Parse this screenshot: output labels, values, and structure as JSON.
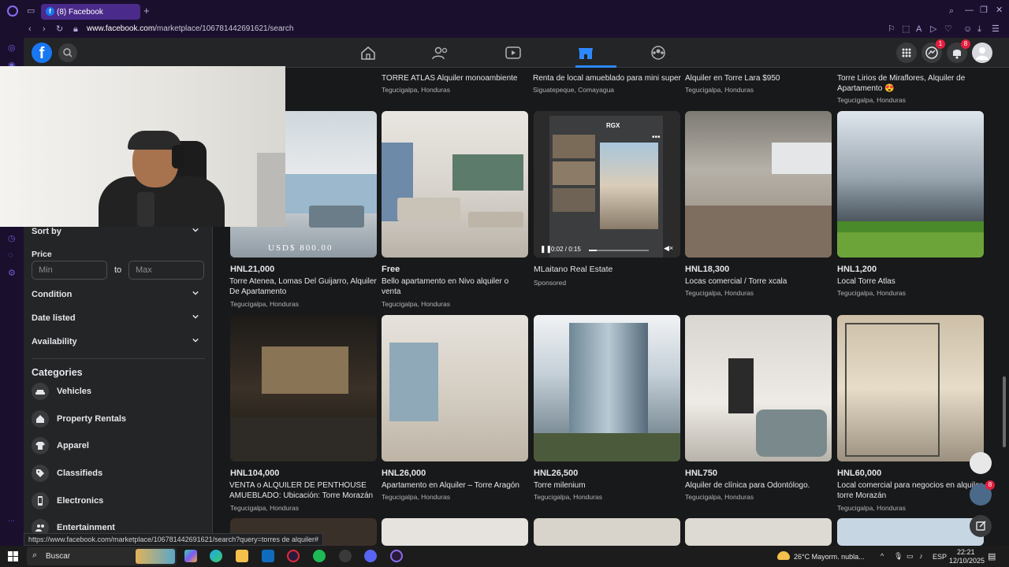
{
  "browser": {
    "tab_title": "(8) Facebook",
    "url_host": "www.facebook.com",
    "url_path": "/marketplace/106781442691621/search"
  },
  "header": {
    "badges": {
      "messenger": "1",
      "notifications": "8"
    }
  },
  "sidebar": {
    "sort_label": "Sort by",
    "price_label": "Price",
    "min_placeholder": "Min",
    "to_label": "to",
    "max_placeholder": "Max",
    "condition_label": "Condition",
    "date_label": "Date listed",
    "availability_label": "Availability",
    "categories_heading": "Categories",
    "categories": [
      {
        "label": "Vehicles",
        "icon": "car-icon"
      },
      {
        "label": "Property Rentals",
        "icon": "house-icon"
      },
      {
        "label": "Apparel",
        "icon": "shirt-icon"
      },
      {
        "label": "Classifieds",
        "icon": "tag-icon"
      },
      {
        "label": "Electronics",
        "icon": "phone-icon"
      },
      {
        "label": "Entertainment",
        "icon": "people-icon"
      }
    ]
  },
  "top_row": [
    {
      "title": "TORRE ATLAS Alquiler monoambiente",
      "location": "Tegucigalpa, Honduras"
    },
    {
      "title": "Renta de local amueblado para mini super",
      "location": "Siguatepeque, Comayagua"
    },
    {
      "title": "Alquiler en Torre Lara $950",
      "location": "Tegucigalpa, Honduras"
    },
    {
      "title": "Torre Lirios de Miraflores, Alquiler de Apartamento 😍",
      "location": "Tegucigalpa, Honduras"
    }
  ],
  "row1": [
    {
      "price": "HNL21,000",
      "title": "Torre Atenea, Lomas Del Guijarro, Alquiler De Apartamento",
      "location": "Tegucigalpa, Honduras",
      "img_caption": "USD$ 800.00"
    },
    {
      "price": "Free",
      "title": "Bello apartamento en Nivo alquiler o venta",
      "location": "Tegucigalpa, Honduras"
    },
    {
      "price": "MLaitano Real Estate",
      "title": "Sponsored",
      "location": "",
      "video_time": "0:02 / 0:15",
      "video_label": "RGX"
    },
    {
      "price": "HNL18,300",
      "title": "Locas comercial / Torre xcala",
      "location": "Tegucigalpa, Honduras"
    },
    {
      "price": "HNL1,200",
      "title": "Local Torre Atlas",
      "location": "Tegucigalpa, Honduras"
    }
  ],
  "row2": [
    {
      "price": "HNL104,000",
      "title": "VENTA o ALQUILER DE PENTHOUSE AMUEBLADO: Ubicación: Torre Morazán",
      "location": "Tegucigalpa, Honduras"
    },
    {
      "price": "HNL26,000",
      "title": "Apartamento en Alquiler – Torre Aragón",
      "location": "Tegucigalpa, Honduras"
    },
    {
      "price": "HNL26,500",
      "title": "Torre milenium",
      "location": "Tegucigalpa, Honduras"
    },
    {
      "price": "HNL750",
      "title": "Alquiler de clínica para Odontólogo.",
      "location": "Tegucigalpa, Honduras"
    },
    {
      "price": "HNL60,000",
      "title": "Local comercial para negocios en alquiler torre Morazán",
      "location": "Tegucigalpa, Honduras"
    }
  ],
  "floating_badge": "8",
  "status_link": "https://www.facebook.com/marketplace/106781442691621/search?query=torres de alquiler#",
  "taskbar": {
    "search_label": "Buscar",
    "weather": "26°C  Mayorm. nubla...",
    "lang": "ESP",
    "time": "22:21",
    "date": "12/10/2025"
  }
}
